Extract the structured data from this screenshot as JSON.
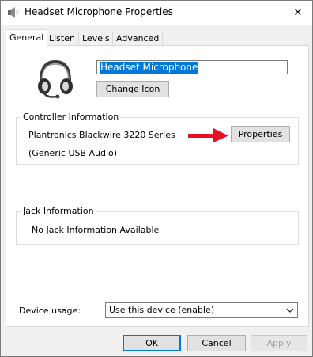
{
  "window": {
    "title": "Headset Microphone Properties",
    "close_glyph": "✕"
  },
  "tabs": [
    {
      "label": "General",
      "active": true
    },
    {
      "label": "Listen",
      "active": false
    },
    {
      "label": "Levels",
      "active": false
    },
    {
      "label": "Advanced",
      "active": false
    }
  ],
  "general": {
    "device_icon": "headset-icon",
    "device_name": "Headset Microphone",
    "change_icon_label": "Change Icon",
    "controller": {
      "title": "Controller Information",
      "name": "Plantronics Blackwire 3220 Series",
      "driver": "(Generic USB Audio)",
      "properties_label": "Properties",
      "arrow_color": "#e81123"
    },
    "jack": {
      "title": "Jack Information",
      "text": "No Jack Information Available"
    },
    "device_usage": {
      "label": "Device usage:",
      "value": "Use this device (enable)"
    }
  },
  "footer": {
    "ok_label": "OK",
    "cancel_label": "Cancel",
    "apply_label": "Apply"
  }
}
